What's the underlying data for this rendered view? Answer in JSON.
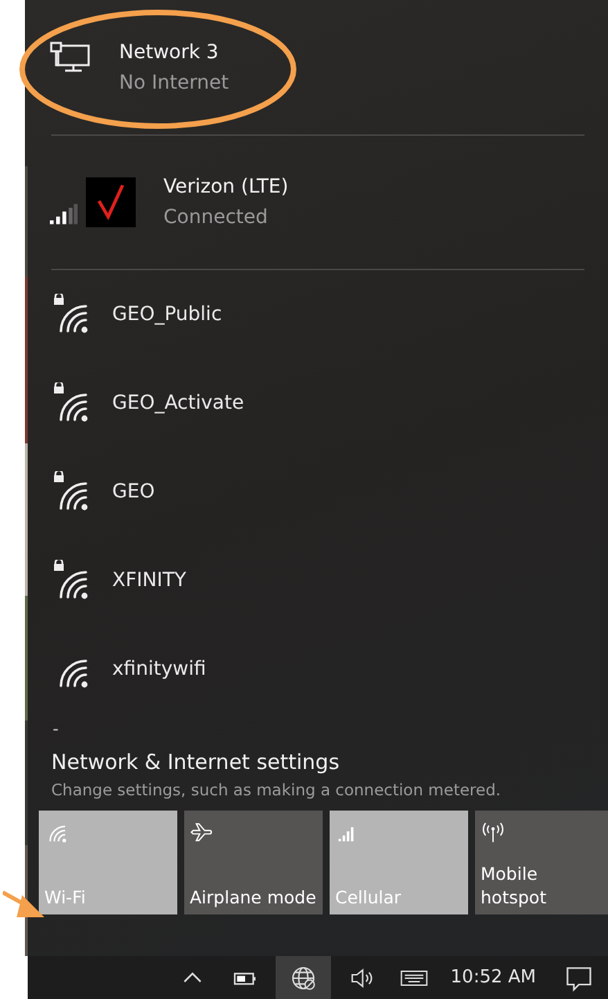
{
  "connections": [
    {
      "kind": "ethernet",
      "name": "Network 3",
      "status": "No Internet"
    },
    {
      "kind": "cellular",
      "name": "Verizon (LTE)",
      "status": "Connected"
    }
  ],
  "wifi_networks": [
    {
      "name": "GEO_Public",
      "secured": true
    },
    {
      "name": "GEO_Activate",
      "secured": true
    },
    {
      "name": "GEO",
      "secured": true
    },
    {
      "name": "XFINITY",
      "secured": true
    },
    {
      "name": "xfinitywifi",
      "secured": false
    }
  ],
  "more_mark": "-",
  "settings": {
    "title": "Network & Internet settings",
    "subtitle": "Change settings, such as making a connection metered."
  },
  "quick_actions": [
    {
      "kind": "wifi",
      "label": "Wi-Fi",
      "on": true
    },
    {
      "kind": "airplane",
      "label": "Airplane mode",
      "on": false
    },
    {
      "kind": "cellular",
      "label": "Cellular",
      "on": true
    },
    {
      "kind": "hotspot",
      "label": "Mobile hotspot",
      "on": false
    }
  ],
  "taskbar": {
    "tray": [
      {
        "kind": "chevron",
        "selected": false
      },
      {
        "kind": "battery",
        "selected": false
      },
      {
        "kind": "network",
        "selected": true
      },
      {
        "kind": "volume",
        "selected": false
      },
      {
        "kind": "keyboard",
        "selected": false
      }
    ],
    "clock": "10:52 AM"
  }
}
